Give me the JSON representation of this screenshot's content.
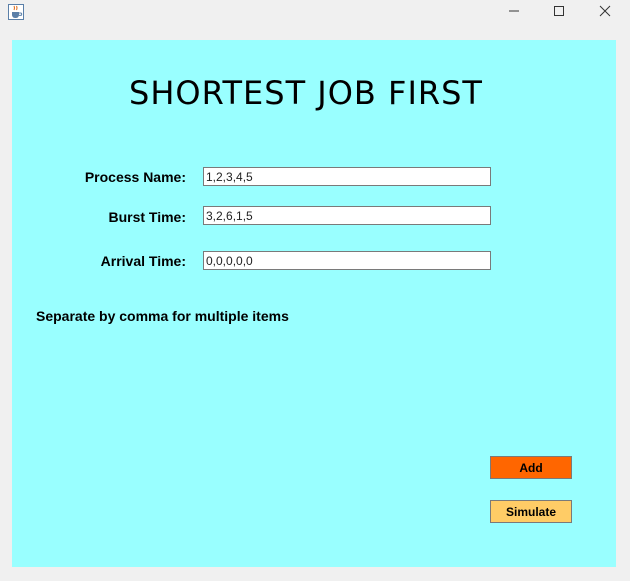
{
  "window": {
    "app_icon": "java-cup-icon",
    "controls": [
      "minimize-icon",
      "maximize-icon",
      "close-icon"
    ]
  },
  "main": {
    "title": "SHORTEST JOB FIRST",
    "fields": {
      "process_name": {
        "label": "Process Name:",
        "value": "1,2,3,4,5"
      },
      "burst_time": {
        "label": "Burst Time:",
        "value": "3,2,6,1,5"
      },
      "arrival_time": {
        "label": "Arrival Time:",
        "value": "0,0,0,0,0"
      }
    },
    "hint": "Separate by comma for multiple items",
    "buttons": {
      "add": {
        "label": "Add",
        "color": "#ff6600"
      },
      "simulate": {
        "label": "Simulate",
        "color": "#ffcc66"
      }
    }
  },
  "colors": {
    "panel_background": "#99ffff",
    "window_background": "#f0f0f0"
  }
}
